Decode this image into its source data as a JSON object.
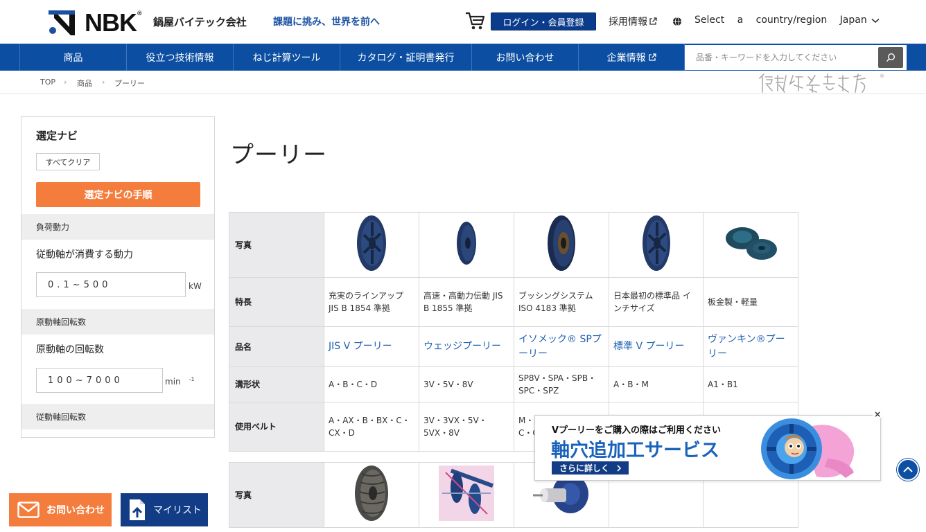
{
  "header": {
    "logo_text": "NBK",
    "logo_reg": "®",
    "company_name": "鍋屋バイテック会社",
    "tagline": "課題に挑み、世界を前へ",
    "login_label": "ログイン・会員登録",
    "recruit_label": "採用情報",
    "region_label": "Select a country/region",
    "country_label": "Japan"
  },
  "nav": {
    "items": [
      "商品",
      "役立つ技術情報",
      "ねじ計算ツール",
      "カタログ・証明書発行",
      "お問い合わせ",
      "企業情報"
    ],
    "search_placeholder": "品番・キーワードを入力してください"
  },
  "breadcrumb": [
    "TOP",
    "商品",
    "プーリー"
  ],
  "sidebar": {
    "title": "選定ナビ",
    "clear_label": "すべてクリア",
    "guide_label": "選定ナビの手順",
    "section1": "負荷動力",
    "label1": "従動軸が消費する動力",
    "input1_value": "0.1~500",
    "unit1": "kW",
    "section2": "原動軸回転数",
    "label2": "原動軸の回転数",
    "input2_value": "100~7000",
    "unit2": "min",
    "unit2_sup": "-1",
    "section3": "従動軸回転数"
  },
  "page_title": "プーリー",
  "table1": {
    "row_heads": [
      "写真",
      "特長",
      "品名",
      "溝形状",
      "使用ベルト"
    ],
    "features": [
      "充実のラインアップ JIS B 1854 準拠",
      "高速・高動力伝動 JIS B 1855 準拠",
      "ブッシングシステム ISO 4183 準拠",
      "日本最初の標準品 インチサイズ",
      "板金製・軽量"
    ],
    "names": [
      "JIS V プーリー",
      "ウェッジプーリー",
      "イソメック® SPプーリー",
      "標準 V プーリー",
      "ヴァンキン®プーリー"
    ],
    "grooves": [
      "A・B・C・D",
      "3V・5V・8V",
      "SP8V・SPA・SPB・SPC・SPZ",
      "A・B・M",
      "A1・B1"
    ],
    "belts": [
      "A・AX・B・BX・C・CX・D",
      "3V・3VX・5V・5VX・8V",
      "M・A・AX・B・BX・C・CX・5V",
      "",
      ""
    ]
  },
  "table2": {
    "row_heads": [
      "写真"
    ]
  },
  "banner": {
    "subtitle": "Vプーリーをご購入の際はご利用ください",
    "title": "軸穴追加工サービス",
    "more_label": "さらに詳しく",
    "close_label": "×"
  },
  "floating": {
    "contact_label": "お問い合わせ",
    "mylist_label": "マイリスト"
  },
  "colors": {
    "brand_blue": "#0b4ea2",
    "accent_orange": "#f47c3c",
    "link_blue": "#1e5fb3",
    "dark_navy": "#123d86"
  }
}
